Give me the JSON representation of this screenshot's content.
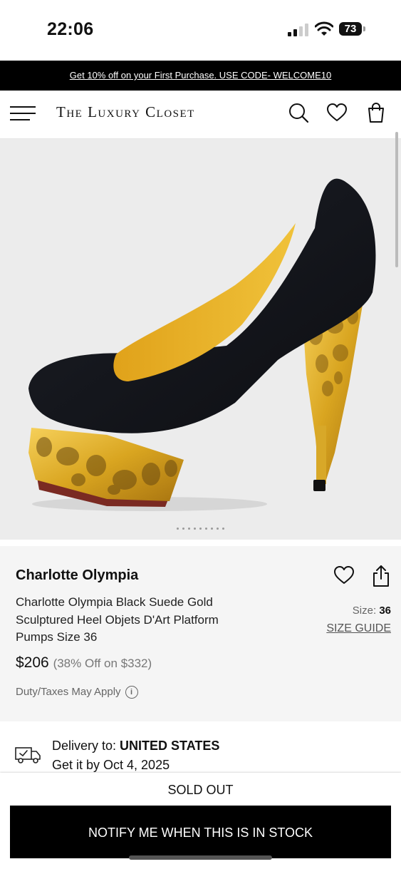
{
  "status_bar": {
    "time": "22:06",
    "battery": "73"
  },
  "promo": {
    "text": "Get 10% off on your First Purchase. USE CODE- WELCOME10"
  },
  "header": {
    "logo": "The Luxury Closet"
  },
  "gallery": {
    "image_count": 9,
    "active_index": 0
  },
  "product": {
    "brand": "Charlotte Olympia",
    "title": "Charlotte Olympia Black Suede Gold Sculptured Heel Objets D'Art Platform Pumps Size 36",
    "size_label": "Size: ",
    "size_value": "36",
    "size_guide": "SIZE GUIDE",
    "price": "$206",
    "discount": "(38% Off on $332)",
    "duty": "Duty/Taxes May Apply"
  },
  "delivery": {
    "label": "Delivery to: ",
    "country": "UNITED STATES",
    "eta": "Get it by Oct 4, 2025"
  },
  "actions": {
    "sold_out": "SOLD OUT",
    "notify": "NOTIFY ME WHEN THIS IS IN STOCK"
  },
  "colors": {
    "accent": "#000000",
    "gold": "#d9a520",
    "suede": "#111318",
    "panel": "#f5f5f5",
    "gallery_bg": "#ececec"
  }
}
